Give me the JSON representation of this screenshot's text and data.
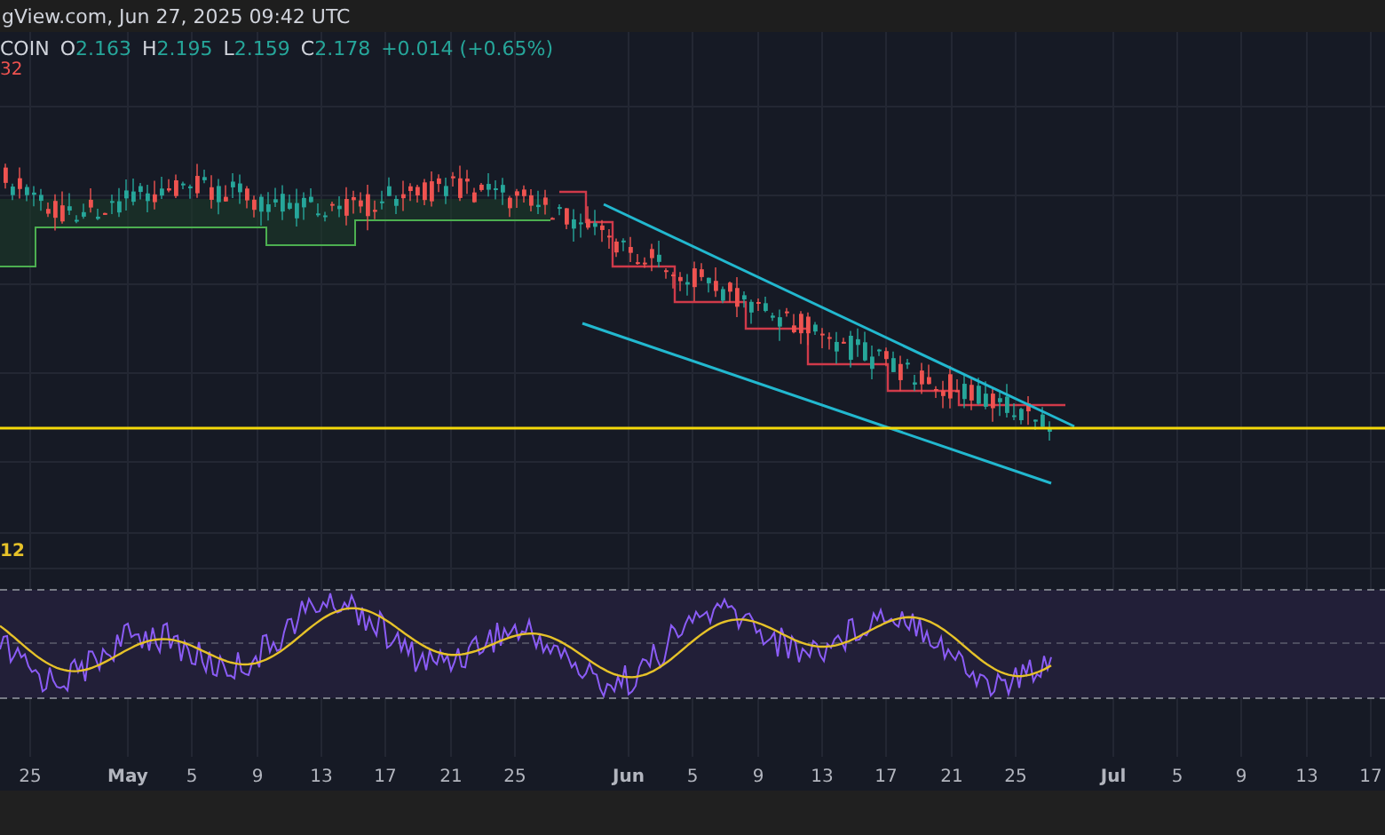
{
  "header": {
    "text": "gView.com, Jun 27, 2025 09:42 UTC"
  },
  "legend": {
    "symbol": "COIN",
    "items": [
      {
        "label": "O",
        "value": "2.163"
      },
      {
        "label": "H",
        "value": "2.195"
      },
      {
        "label": "L",
        "value": "2.159"
      },
      {
        "label": "C",
        "value": "2.178"
      }
    ],
    "change": "+0.014 (+0.65%)",
    "indicator_value": "32"
  },
  "rsi_pane": {
    "label": "12"
  },
  "x_axis": [
    {
      "label": "25",
      "kind": "day"
    },
    {
      "label": "May",
      "kind": "month"
    },
    {
      "label": "5",
      "kind": "day"
    },
    {
      "label": "9",
      "kind": "day"
    },
    {
      "label": "13",
      "kind": "day"
    },
    {
      "label": "17",
      "kind": "day"
    },
    {
      "label": "21",
      "kind": "day"
    },
    {
      "label": "25",
      "kind": "day"
    },
    {
      "label": "Jun",
      "kind": "month"
    },
    {
      "label": "5",
      "kind": "day"
    },
    {
      "label": "9",
      "kind": "day"
    },
    {
      "label": "13",
      "kind": "day"
    },
    {
      "label": "17",
      "kind": "day"
    },
    {
      "label": "21",
      "kind": "day"
    },
    {
      "label": "25",
      "kind": "day"
    },
    {
      "label": "Jul",
      "kind": "month"
    },
    {
      "label": "5",
      "kind": "day"
    },
    {
      "label": "9",
      "kind": "day"
    },
    {
      "label": "13",
      "kind": "day"
    },
    {
      "label": "17",
      "kind": "day"
    }
  ]
}
